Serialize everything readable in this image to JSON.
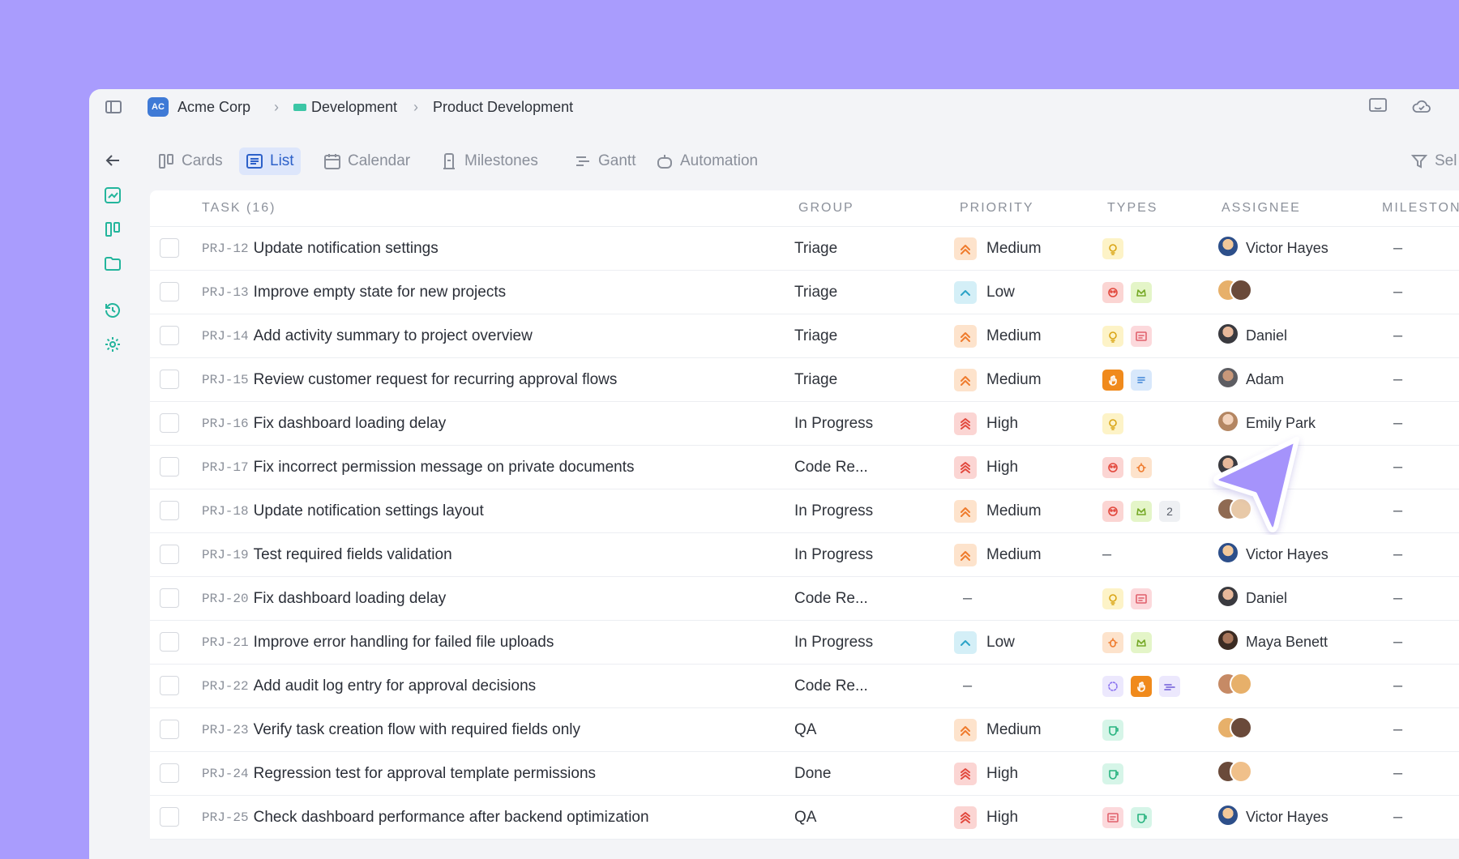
{
  "breadcrumb": {
    "workspace_badge": "AC",
    "workspace": "Acme Corp",
    "team": "Development",
    "project": "Product Development"
  },
  "tabs": [
    {
      "label": "Cards",
      "icon": "cards-icon"
    },
    {
      "label": "List",
      "icon": "list-icon",
      "active": true
    },
    {
      "label": "Calendar",
      "icon": "calendar-icon"
    },
    {
      "label": "Milestones",
      "icon": "milestone-icon"
    },
    {
      "label": "Gantt",
      "icon": "gantt-icon"
    },
    {
      "label": "Automation",
      "icon": "robot-icon"
    }
  ],
  "tab_right_label": "Sel",
  "table": {
    "headers": {
      "task": "TASK (16)",
      "group": "GROUP",
      "priority": "PRIORITY",
      "types": "TYPES",
      "assignee": "ASSIGNEE",
      "milestone": "MILESTON"
    },
    "rows": [
      {
        "id": "PRJ-12",
        "title": "Update notification settings",
        "group": "Triage",
        "priority": "Medium",
        "types": [
          "idea"
        ],
        "assignee": "Victor Hayes",
        "avatars": [
          "victor"
        ],
        "milestone": "–"
      },
      {
        "id": "PRJ-13",
        "title": "Improve empty state for new projects",
        "group": "Triage",
        "priority": "Low",
        "types": [
          "design",
          "feature"
        ],
        "assignee": "",
        "avatars": [
          "a1",
          "a2"
        ],
        "milestone": "–"
      },
      {
        "id": "PRJ-14",
        "title": "Add activity summary to project overview",
        "group": "Triage",
        "priority": "Medium",
        "types": [
          "idea",
          "ui"
        ],
        "assignee": "Daniel",
        "avatars": [
          "daniel"
        ],
        "milestone": "–"
      },
      {
        "id": "PRJ-15",
        "title": "Review customer request for recurring approval flows",
        "group": "Triage",
        "priority": "Medium",
        "types": [
          "request",
          "docs"
        ],
        "assignee": "Adam",
        "avatars": [
          "adam"
        ],
        "milestone": "–"
      },
      {
        "id": "PRJ-16",
        "title": "Fix dashboard loading delay",
        "group": "In Progress",
        "priority": "High",
        "types": [
          "idea"
        ],
        "assignee": "Emily Park",
        "avatars": [
          "emily"
        ],
        "milestone": "–"
      },
      {
        "id": "PRJ-17",
        "title": "Fix incorrect permission message on private documents",
        "group": "Code Re...",
        "priority": "High",
        "types": [
          "design",
          "bug"
        ],
        "assignee": "Daniel",
        "avatars": [
          "daniel"
        ],
        "milestone": "–"
      },
      {
        "id": "PRJ-18",
        "title": "Update notification settings layout",
        "group": "In Progress",
        "priority": "Medium",
        "types": [
          "design",
          "feature"
        ],
        "type_count": "2",
        "assignee": "",
        "avatars": [
          "a3",
          "a4"
        ],
        "milestone": "–"
      },
      {
        "id": "PRJ-19",
        "title": "Test required fields validation",
        "group": "In Progress",
        "priority": "Medium",
        "types": [],
        "assignee": "Victor Hayes",
        "avatars": [
          "victor"
        ],
        "milestone": "–"
      },
      {
        "id": "PRJ-20",
        "title": "Fix dashboard loading delay",
        "group": "Code Re...",
        "priority": "",
        "types": [
          "idea",
          "ui"
        ],
        "assignee": "Daniel",
        "avatars": [
          "daniel"
        ],
        "milestone": "–"
      },
      {
        "id": "PRJ-21",
        "title": "Improve error handling for failed file uploads",
        "group": "In Progress",
        "priority": "Low",
        "types": [
          "bug",
          "feature"
        ],
        "assignee": "Maya Benett",
        "avatars": [
          "maya"
        ],
        "milestone": "–"
      },
      {
        "id": "PRJ-22",
        "title": "Add audit log entry for approval decisions",
        "group": "Code Re...",
        "priority": "",
        "types": [
          "loading",
          "request",
          "perf"
        ],
        "assignee": "",
        "avatars": [
          "a5",
          "a6"
        ],
        "milestone": "–"
      },
      {
        "id": "PRJ-23",
        "title": "Verify task creation flow with required fields only",
        "group": "QA",
        "priority": "Medium",
        "types": [
          "test"
        ],
        "assignee": "",
        "avatars": [
          "a7",
          "a8"
        ],
        "milestone": "–"
      },
      {
        "id": "PRJ-24",
        "title": "Regression test for approval template permissions",
        "group": "Done",
        "priority": "High",
        "types": [
          "test"
        ],
        "assignee": "",
        "avatars": [
          "a9",
          "a10"
        ],
        "milestone": "–"
      },
      {
        "id": "PRJ-25",
        "title": "Check dashboard performance after backend optimization",
        "group": "QA",
        "priority": "High",
        "types": [
          "ui",
          "test"
        ],
        "assignee": "Victor Hayes",
        "avatars": [
          "victor"
        ],
        "milestone": "–"
      }
    ]
  },
  "colors": {
    "background": "#a99cfd",
    "accent": "#2d61c9",
    "rail": "#23b59c",
    "cursor": "#a593fb"
  }
}
